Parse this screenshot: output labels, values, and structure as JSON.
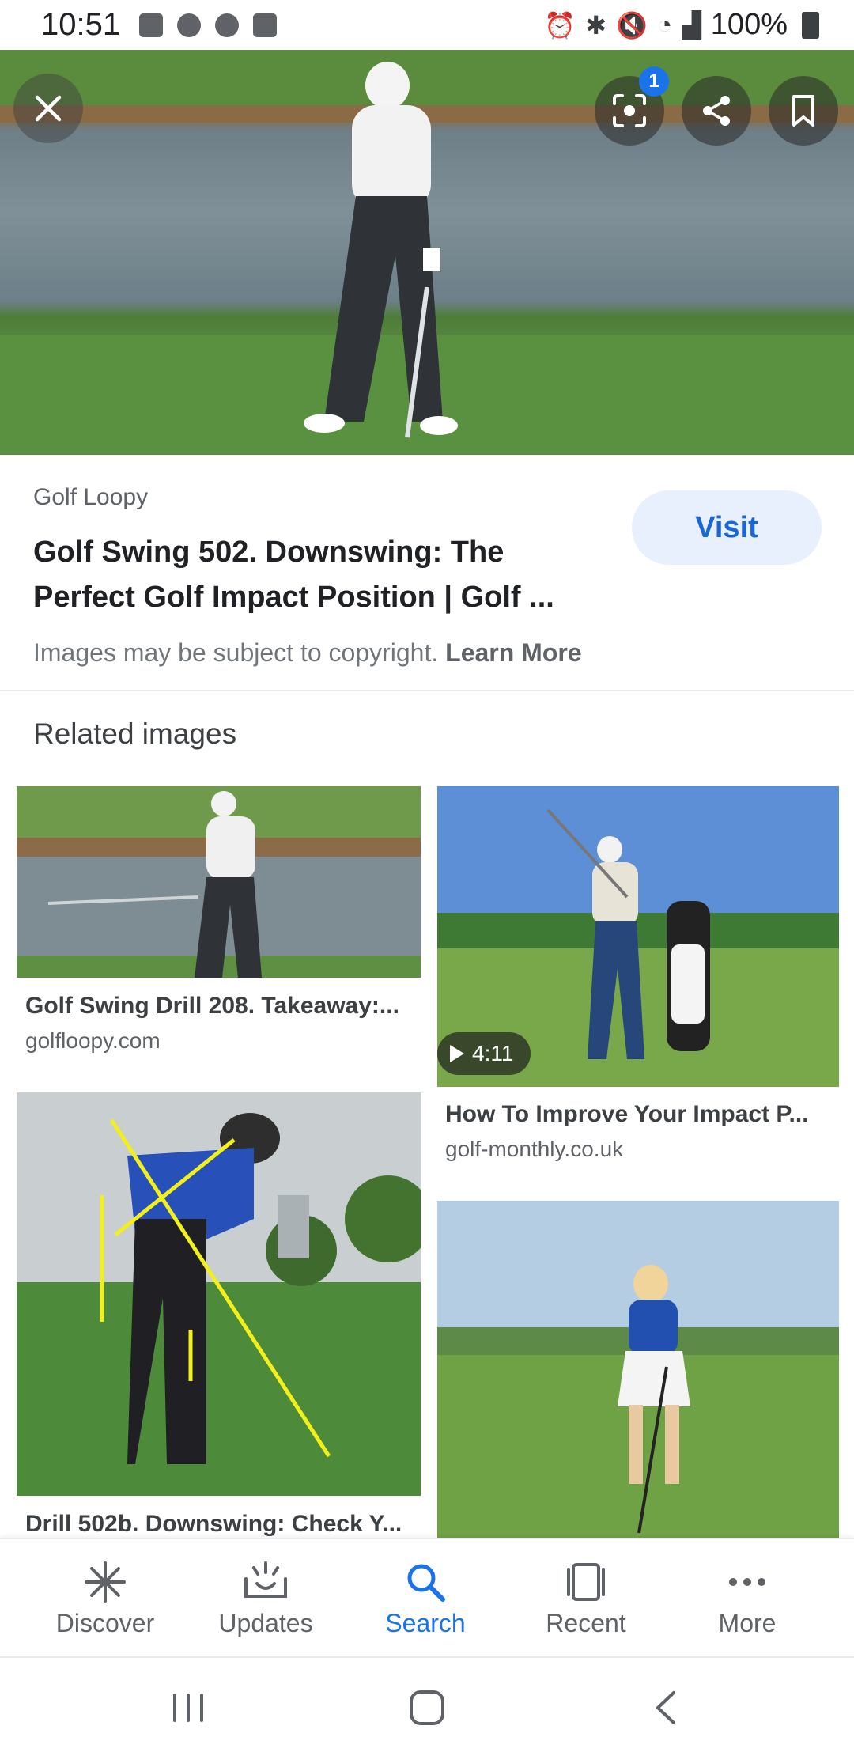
{
  "status_bar": {
    "time": "10:51",
    "battery": "100%"
  },
  "hero": {
    "badge_count": "1"
  },
  "result": {
    "source": "Golf Loopy",
    "title_line1": "Golf Swing 502. Downswing: The",
    "title_line2": "Perfect Golf Impact Position | Golf ...",
    "visit_label": "Visit",
    "copyright_text": "Images may be subject to copyright.",
    "learn_more": "Learn More"
  },
  "related": {
    "heading": "Related images",
    "items": [
      {
        "title": "Golf Swing Drill 208. Takeaway:...",
        "domain": "golfloopy.com"
      },
      {
        "title": "How To Improve Your Impact P...",
        "domain": "golf-monthly.co.uk",
        "duration": "4:11"
      },
      {
        "title": "Drill 502b. Downswing: Check Y..."
      }
    ]
  },
  "bottom_nav": {
    "items": [
      {
        "label": "Discover"
      },
      {
        "label": "Updates"
      },
      {
        "label": "Search"
      },
      {
        "label": "Recent"
      },
      {
        "label": "More"
      }
    ]
  },
  "colors": {
    "accent": "#1a73e8",
    "visit_bg": "#e8f0fe"
  }
}
